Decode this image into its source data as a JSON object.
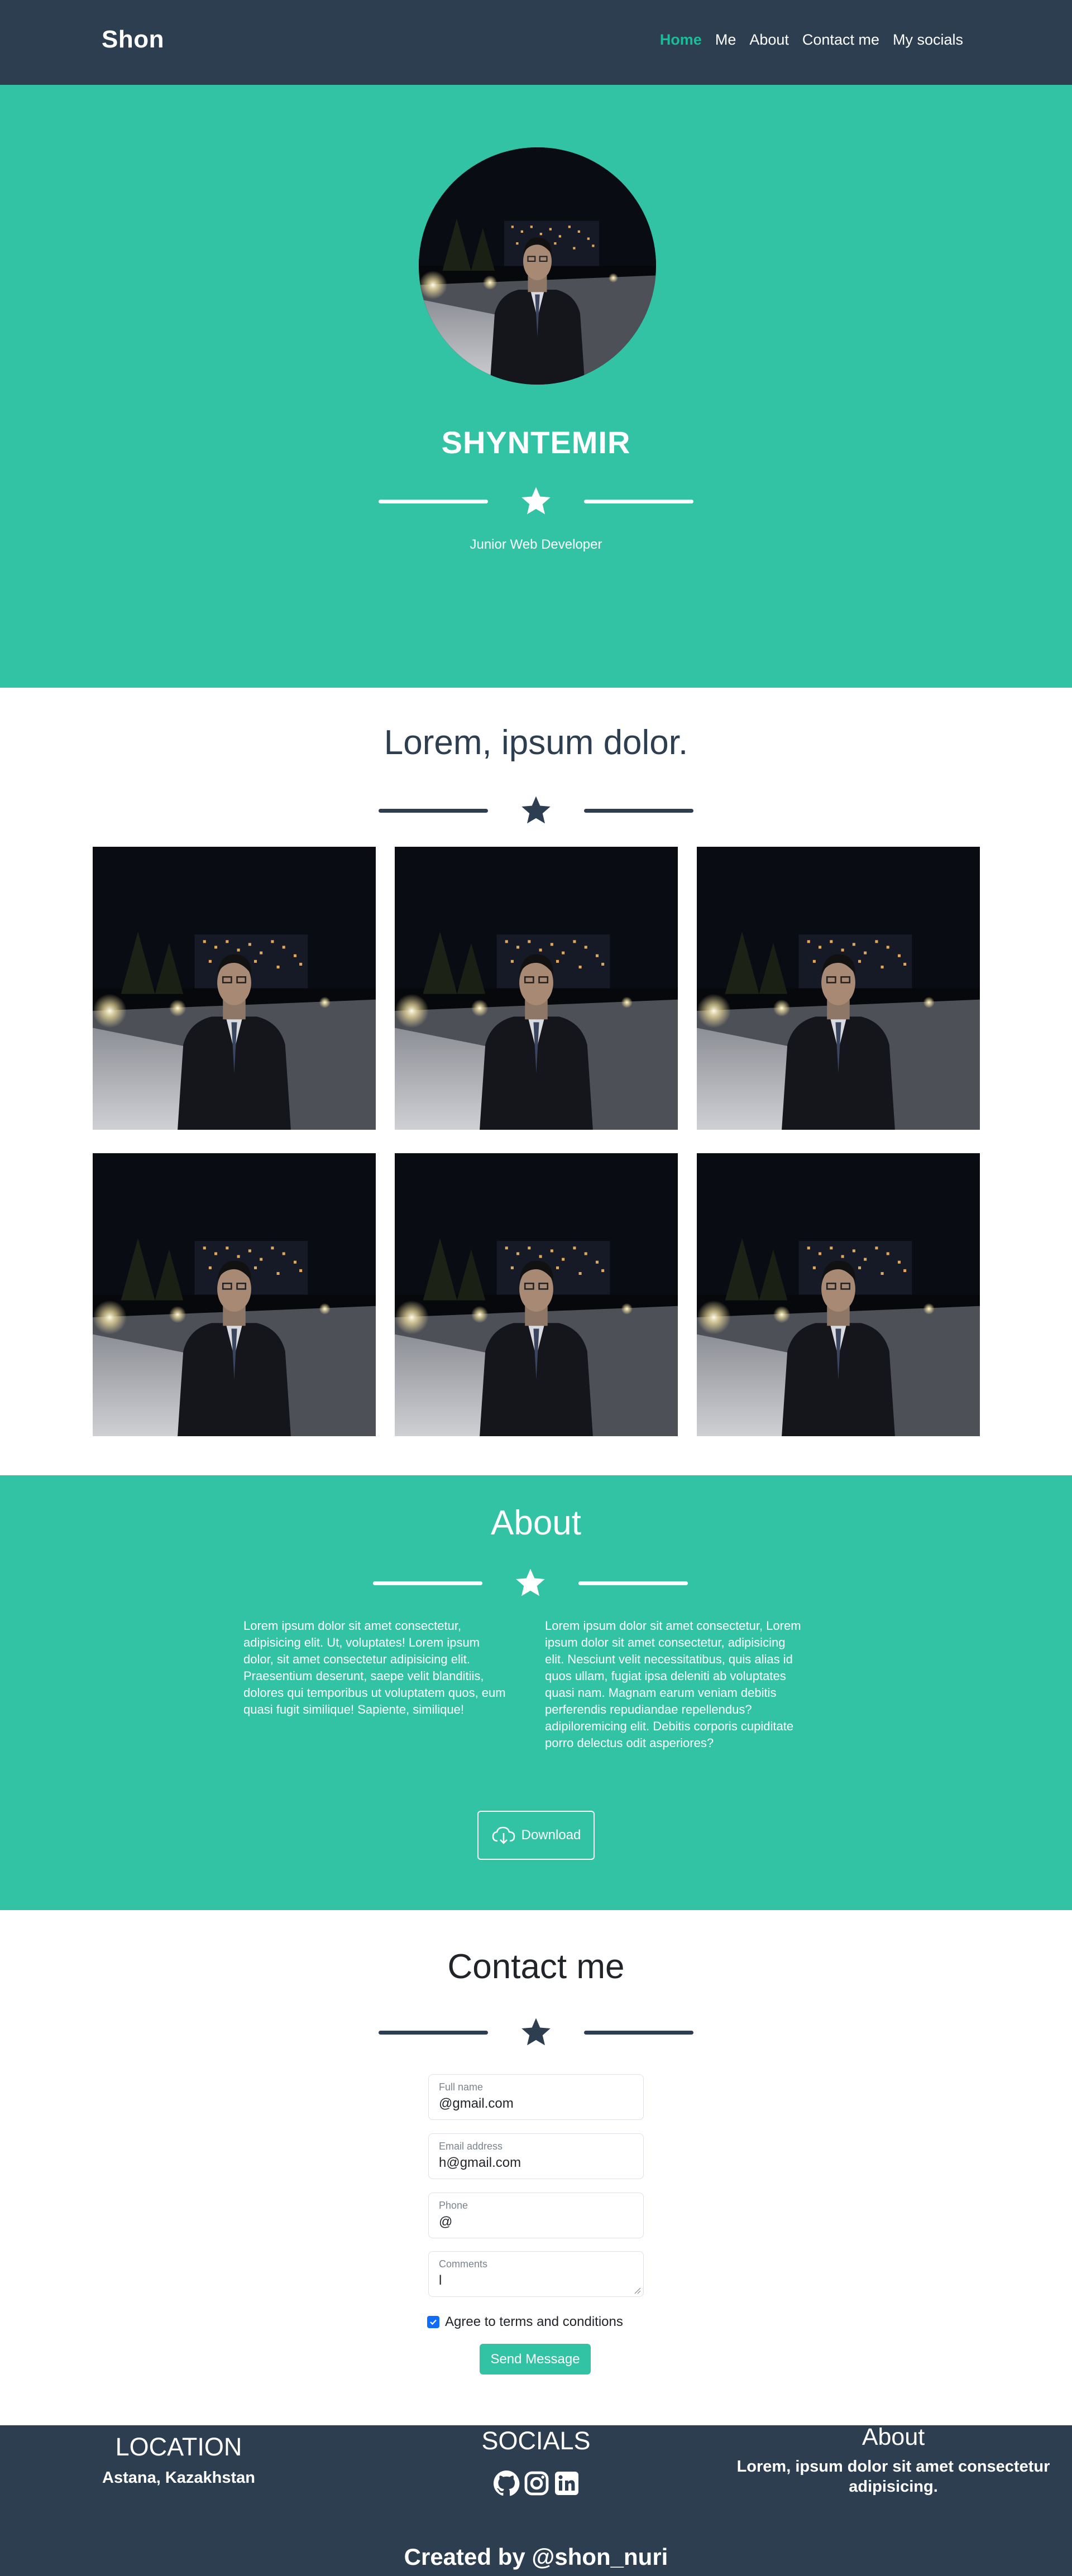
{
  "nav": {
    "brand": "Shon",
    "links": [
      "Home",
      "Me",
      "About",
      "Contact me",
      "My socials"
    ]
  },
  "hero": {
    "name": "SHYNTEMIR",
    "subtitle": "Junior Web Developer"
  },
  "portfolio": {
    "title": "Lorem, ipsum dolor."
  },
  "about": {
    "title": "About",
    "left_text": "Lorem ipsum dolor sit amet consectetur, adipisicing elit. Ut, voluptates! Lorem ipsum dolor, sit amet consectetur adipisicing elit. Praesentium deserunt, saepe velit blanditiis, dolores qui temporibus ut voluptatem quos, eum quasi fugit similique! Sapiente, similique!",
    "right_text": "Lorem ipsum dolor sit amet consectetur, Lorem ipsum dolor sit amet consectetur, adipisicing elit. Nesciunt velit necessitatibus, quis alias id quos ullam, fugiat ipsa deleniti ab voluptates quasi nam. Magnam earum veniam debitis perferendis repudiandae repellendus? adipiloremicing elit. Debitis corporis cupiditate porro delectus odit asperiores?",
    "download_label": "Download"
  },
  "contact": {
    "title": "Contact me",
    "fields": {
      "fullname": {
        "label": "Full name",
        "value": "@gmail.com"
      },
      "email": {
        "label": "Email address",
        "value": "h@gmail.com"
      },
      "phone": {
        "label": "Phone",
        "value": "@"
      },
      "comments": {
        "label": "Comments",
        "value": "l"
      }
    },
    "agree_label": "Agree to terms and conditions",
    "agree_checked": true,
    "send_label": "Send Message"
  },
  "footer": {
    "location_title": "LOCATION",
    "location_text": "Astana, Kazakhstan",
    "socials_title": "SOCIALS",
    "social_icons": [
      "github-icon",
      "instagram-icon",
      "linkedin-icon"
    ],
    "about_title": "About",
    "about_text": "Lorem, ipsum dolor sit amet consectetur adipisicing.",
    "credits": "Created by @shon_nuri"
  },
  "colors": {
    "primary": "#31c3a3",
    "dark": "#2c3e50",
    "nav_active": "#1abc9c"
  }
}
